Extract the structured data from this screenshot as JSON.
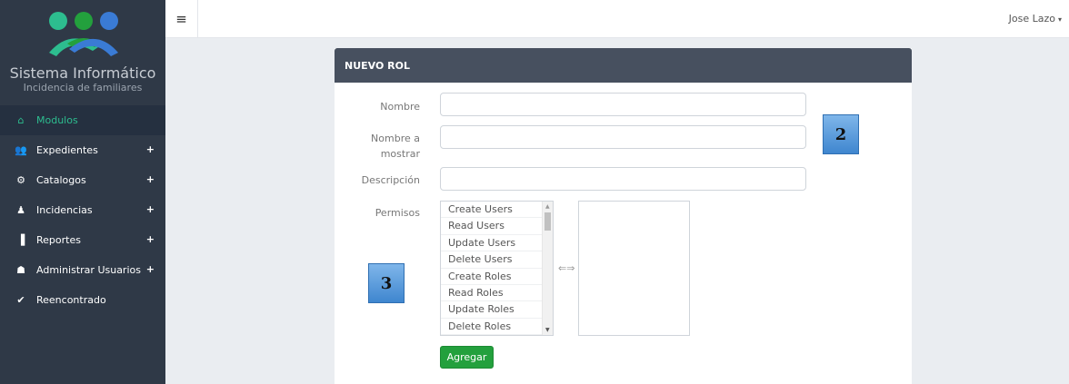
{
  "brand": {
    "title": "Sistema Informático",
    "subtitle": "Incidencia de familiares",
    "logo_colors": [
      "#2dbd8f",
      "#23a03d",
      "#3a7bd5"
    ]
  },
  "sidebar": {
    "items": [
      {
        "label": "Modulos",
        "icon": "home-icon",
        "glyph": "⌂",
        "expandable": false,
        "active": true
      },
      {
        "label": "Expedientes",
        "icon": "users-icon",
        "glyph": "👥",
        "expandable": true,
        "active": false
      },
      {
        "label": "Catalogos",
        "icon": "cogs-icon",
        "glyph": "⚙",
        "expandable": true,
        "active": false
      },
      {
        "label": "Incidencias",
        "icon": "person-icon",
        "glyph": "♟",
        "expandable": true,
        "active": false
      },
      {
        "label": "Reportes",
        "icon": "file-icon",
        "glyph": "▐",
        "expandable": true,
        "active": false
      },
      {
        "label": "Administrar Usuarios",
        "icon": "user-icon",
        "glyph": "☗",
        "expandable": true,
        "active": false
      },
      {
        "label": "Reencontrado",
        "icon": "check-icon",
        "glyph": "✔",
        "expandable": false,
        "active": false
      }
    ],
    "plus_label": "+"
  },
  "topbar": {
    "menu_glyph": "≡",
    "user_name": "Jose Lazo",
    "caret": "▾"
  },
  "panel": {
    "title": "NUEVO ROL",
    "labels": {
      "nombre": "Nombre",
      "nombre_mostrar_1": "Nombre a",
      "nombre_mostrar_2": "mostrar",
      "descripcion": "Descripción",
      "permisos": "Permisos"
    },
    "permisos_options": [
      "Create Users",
      "Read Users",
      "Update Users",
      "Delete Users",
      "Create Roles",
      "Read Roles",
      "Update Roles",
      "Delete Roles"
    ],
    "transfer_glyph": "⇐⇒",
    "add_button": "Agregar"
  },
  "badges": {
    "two": "2",
    "three": "3"
  }
}
